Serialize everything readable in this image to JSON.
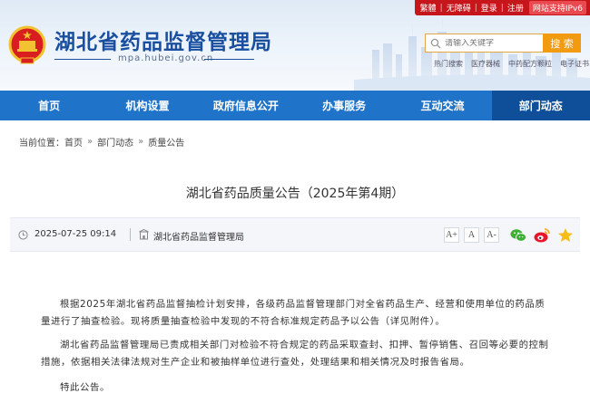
{
  "header": {
    "site_title": "湖北省药品监督管理局",
    "site_url": "mpa.hubei.gov.cn",
    "top_links": [
      "繁體",
      "无障碍",
      "登录",
      "注册"
    ],
    "ipv6_label": "网站支持IPv6",
    "search_placeholder": "请输入关键字",
    "search_button": "搜 索",
    "hot_words": [
      "热门搜索",
      "医疗器械",
      "中药配方颗粒",
      "电子证书"
    ]
  },
  "nav": {
    "items": [
      {
        "label": "首页",
        "active": false
      },
      {
        "label": "机构设置",
        "active": false
      },
      {
        "label": "政府信息公开",
        "active": false
      },
      {
        "label": "办事服务",
        "active": false
      },
      {
        "label": "互动交流",
        "active": false
      },
      {
        "label": "部门动态",
        "active": true
      }
    ]
  },
  "breadcrumb": {
    "prefix": "当前位置：",
    "items": [
      "首页",
      "部门动态",
      "质量公告"
    ],
    "separator": "»"
  },
  "article": {
    "title": "湖北省药品质量公告（2025年第4期）",
    "date": "2025-07-25 09:14",
    "source": "湖北省药品监督管理局",
    "font_buttons": [
      "A+",
      "A",
      "A-"
    ],
    "paragraphs": [
      "根据2025年湖北省药品监督抽检计划安排，各级药品监督管理部门对全省药品生产、经营和使用单位的药品质量进行了抽查检验。现将质量抽查检验中发现的不符合标准规定药品予以公告（详见附件）。",
      "湖北省药品监督管理局已责成相关部门对检验不符合规定的药品采取查封、扣押、暂停销售、召回等必要的控制措施，依据相关法律法规对生产企业和被抽样单位进行查处，处理结果和相关情况及时报告省局。",
      "特此公告。"
    ]
  },
  "colors": {
    "nav_bg": "#1f74c9",
    "nav_active": "#0f4f9a",
    "title_blue": "#1a4fa0",
    "top_bar_red": "#c7161b",
    "search_orange": "#f29b11"
  }
}
